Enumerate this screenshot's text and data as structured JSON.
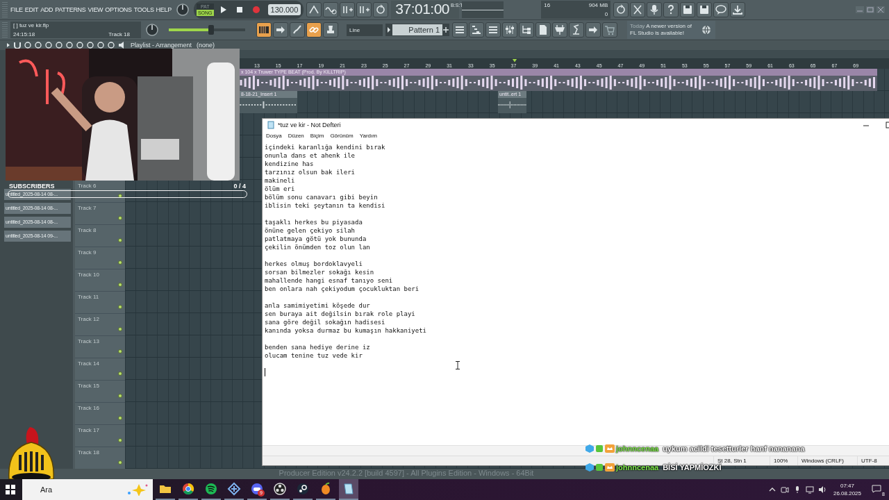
{
  "fl": {
    "menu": [
      "FILE",
      "EDIT",
      "ADD",
      "PATTERNS",
      "VIEW",
      "OPTIONS",
      "TOOLS",
      "HELP"
    ],
    "mode": [
      {
        "label": "PAT",
        "selected": false
      },
      {
        "label": "SONG",
        "selected": true
      }
    ],
    "tempo": "130.000",
    "time": "37:01:00",
    "time_unit": "B:S:T",
    "cpu": "16",
    "memory": "904 MB",
    "polyphony": "0",
    "project": {
      "file": "[  ] tuz ve kir.flp",
      "elapsed": "24:15:18",
      "track": "Track 18"
    },
    "master": {
      "level": 0.55
    },
    "toggles": [
      {
        "on": true
      },
      {
        "on": false
      },
      {
        "on": false
      },
      {
        "on": true
      },
      {
        "on": false
      }
    ],
    "snap": "Line",
    "pattern": "Pattern 1",
    "news": {
      "when": "Today",
      "text": "A newer version of FL Studio is available!"
    },
    "playlist": {
      "title": "Playlist - Arrangement",
      "clip": "(none)",
      "ruler": [
        "13",
        "15",
        "17",
        "19",
        "21",
        "23",
        "25",
        "27",
        "29",
        "31",
        "33",
        "35",
        "37",
        "39",
        "41",
        "43",
        "45",
        "47",
        "49",
        "51",
        "53",
        "55",
        "57",
        "59",
        "61",
        "63",
        "65",
        "67",
        "69"
      ],
      "clips": [
        {
          "name": "x 104 x Truwer TYPE BEAT (Prod. By KILLTRIP)",
          "kind": "audio"
        },
        {
          "name": "8-18-21_Insert 1",
          "kind": "insert"
        },
        {
          "name": "untit..ert 1",
          "kind": "insert"
        }
      ],
      "tracks": [
        "Track 6",
        "Track 7",
        "Track 8",
        "Track 9",
        "Track 10",
        "Track 11",
        "Track 12",
        "Track 13",
        "Track 14",
        "Track 15",
        "Track 16",
        "Track 17",
        "Track 18"
      ]
    },
    "browser": [
      "untitled_2025-08-14 08-...",
      "untitled_2025-08-14 08-...",
      "untitled_2025-08-14 08-...",
      "untitled_2025-08-14 09-..."
    ],
    "footer": "Producer Edition v24.2.2 [build 4597] - All Plugins Edition - Windows - 64Bit"
  },
  "notepad": {
    "title": "*tuz ve kir - Not Defteri",
    "menu": [
      "Dosya",
      "Düzen",
      "Biçim",
      "Görünüm",
      "Yardım"
    ],
    "stanzas": [
      [
        "içindeki karanlığa kendini bırak",
        "onunla dans et ahenk ile",
        "kendizine has",
        "tarzınız olsun bak ileri",
        "makineli",
        "ölüm eri",
        "bölüm sonu canavarı gibi beyin",
        "iblisin teki şeytanın ta kendisi"
      ],
      [
        "taşaklı herkes bu piyasada",
        "önüne gelen çekiyo silah",
        "patlatmaya götü yok bununda",
        "çekilin önümden toz olun lan"
      ],
      [
        "herkes olmuş bordoklavyeli",
        "sorsan bilmezler sokağı kesin",
        "mahallende hangi esnaf tanıyo seni",
        "ben onlara nah çekiyodum çocukluktan beri"
      ],
      [
        "anla samimiyetimi köşede dur",
        "sen buraya ait değilsin bırak role playi",
        "sana göre değil sokağın hadisesi",
        "kanında yoksa durmaz bu kumaşın hakkaniyeti"
      ],
      [
        "benden sana hediye derine iz",
        "olucam tenine tuz vede kir"
      ]
    ],
    "status": [
      "St 28, Stn 1",
      "100%",
      "Windows (CRLF)",
      "UTF-8"
    ]
  },
  "overlay": {
    "subscribers": {
      "label": "SUBSCRIBERS",
      "count": "0 / 4",
      "level": 0
    },
    "chat": [
      {
        "user": "johnncenaa",
        "text": "uykum acildi tesetturler hanf nananana"
      },
      {
        "user": "johnncenaa",
        "text": "BİSİ YAPMİOZKİ"
      }
    ]
  },
  "taskbar": {
    "search": "Ara",
    "apps": [
      {
        "kind": "folder",
        "selected": false
      },
      {
        "kind": "browser",
        "selected": false
      },
      {
        "kind": "music",
        "selected": false
      },
      {
        "kind": "tool",
        "selected": false
      },
      {
        "kind": "chat",
        "selected": false,
        "badge": "9"
      },
      {
        "kind": "record",
        "selected": false
      },
      {
        "kind": "game",
        "selected": false
      },
      {
        "kind": "daw",
        "selected": false
      },
      {
        "kind": "notepad",
        "selected": true
      }
    ],
    "time": "07:47",
    "date": "26.08.2025",
    "notifications": "8"
  }
}
